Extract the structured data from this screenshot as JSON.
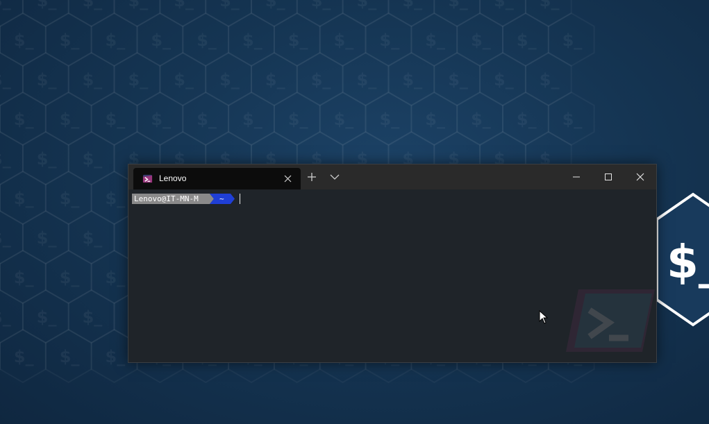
{
  "window": {
    "tab": {
      "title": "Lenovo",
      "icon": "terminal-app-icon"
    },
    "toolbar": {
      "new_tab_icon": "plus-icon",
      "dropdown_icon": "chevron-down-icon"
    },
    "controls": {
      "minimize_icon": "minimize-icon",
      "maximize_icon": "maximize-icon",
      "close_icon": "close-icon"
    }
  },
  "terminal": {
    "prompt_user": "Lenovo@IT-MN-M",
    "prompt_path": "~",
    "background_logo": "powershell-logo"
  },
  "wallpaper": {
    "motif_text": "$_"
  },
  "colors": {
    "desktop_bg": "#153553",
    "titlebar_bg": "#2a2a2a",
    "active_tab_bg": "#0c0c0c",
    "terminal_bg": "#1f2429",
    "prompt_user_bg": "#8a8a8a",
    "prompt_path_bg": "#1f3fd6"
  }
}
